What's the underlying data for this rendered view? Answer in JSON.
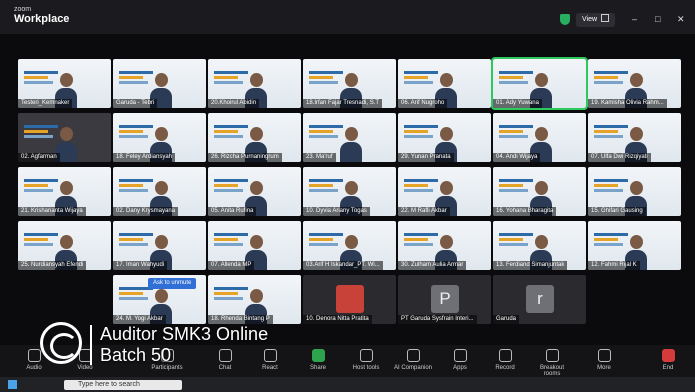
{
  "app": {
    "brand_small": "zoom",
    "brand_big": "Workplace",
    "view_label": "View"
  },
  "participants": [
    {
      "name": "Testeri_Kemnaker",
      "style": "logo"
    },
    {
      "name": "Garuda - Tebri",
      "style": "banner"
    },
    {
      "name": "20.Khoirul Abidin",
      "style": "banner"
    },
    {
      "name": "18.Irfan Fajar Tresnadi, S.T",
      "style": "banner"
    },
    {
      "name": "06. Arif Nugroho",
      "style": "banner"
    },
    {
      "name": "01. Ady Yuwana",
      "style": "active"
    },
    {
      "name": "19. Kamisha Olivia Rahm...",
      "style": "banner"
    },
    {
      "name": "02. Agfarman",
      "style": "dark"
    },
    {
      "name": "18. Feley Ardiansyah",
      "style": "banner"
    },
    {
      "name": "26. Rizcha Purnaningrum",
      "style": "banner"
    },
    {
      "name": "23. Ma'ruf",
      "style": "banner"
    },
    {
      "name": "29. Yunan Pranata",
      "style": "banner"
    },
    {
      "name": "04. Andi Wijaya",
      "style": "banner"
    },
    {
      "name": "07. Ulfa Dwi Rizqiyati",
      "style": "banner"
    },
    {
      "name": "21. Krishananta Wijaya",
      "style": "banner"
    },
    {
      "name": "02. Dany Krysmayana",
      "style": "banner"
    },
    {
      "name": "05. Anita Rufina",
      "style": "banner"
    },
    {
      "name": "10. Dyvia Ariany Togas",
      "style": "banner"
    },
    {
      "name": "22. M Rafli Akbar",
      "style": "banner"
    },
    {
      "name": "16. Yohana Bharagita",
      "style": "banner"
    },
    {
      "name": "15. Ghifari Gausing",
      "style": "banner"
    },
    {
      "name": "25. Nurdiansyah Efendi",
      "style": "banner"
    },
    {
      "name": "17. Iman Wahyudi",
      "style": "banner"
    },
    {
      "name": "07. Allenda MP",
      "style": "banner"
    },
    {
      "name": "03.Arif H Iskandar_PT. Wi...",
      "style": "banner"
    },
    {
      "name": "30. Zulham Aulia Armar",
      "style": "banner"
    },
    {
      "name": "13. Ferdiand Simanjuntak",
      "style": "banner"
    },
    {
      "name": "12. Fahmi Rijal K",
      "style": "banner"
    },
    {
      "name": "24. M. Yogi Akbar",
      "style": "banner"
    },
    {
      "name": "18. Rhenda Bintang P",
      "style": "banner"
    },
    {
      "name": "10. Denora Nitta Pratita",
      "style": "avatar-photo"
    },
    {
      "name": "PT Garuda Sysfrain Interi...",
      "style": "avatar",
      "initial": "P"
    },
    {
      "name": "Garuda",
      "style": "avatar",
      "initial": "r"
    }
  ],
  "tooltip": "Ask to unmute",
  "toolbar": [
    {
      "label": "Audio",
      "icon": "microphone-icon"
    },
    {
      "label": "Video",
      "icon": "video-camera-icon"
    },
    {
      "label": "Participants",
      "icon": "participants-icon"
    },
    {
      "label": "Chat",
      "icon": "chat-icon"
    },
    {
      "label": "React",
      "icon": "heart-icon"
    },
    {
      "label": "Share",
      "icon": "share-screen-icon"
    },
    {
      "label": "Host tools",
      "icon": "shield-icon"
    },
    {
      "label": "AI Companion",
      "icon": "sparkle-icon"
    },
    {
      "label": "Apps",
      "icon": "apps-icon"
    },
    {
      "label": "Record",
      "icon": "record-icon"
    },
    {
      "label": "Breakout rooms",
      "icon": "breakout-rooms-icon"
    },
    {
      "label": "More",
      "icon": "more-icon"
    },
    {
      "label": "End",
      "icon": "end-icon"
    }
  ],
  "taskbar": {
    "search_placeholder": "Type here to search"
  },
  "overlay": {
    "line1": "Auditor SMK3 Online",
    "line2": "Batch 50"
  },
  "colors": {
    "active_speaker": "#2ec95d",
    "end": "#d63b3b",
    "share": "#2fa44f"
  }
}
